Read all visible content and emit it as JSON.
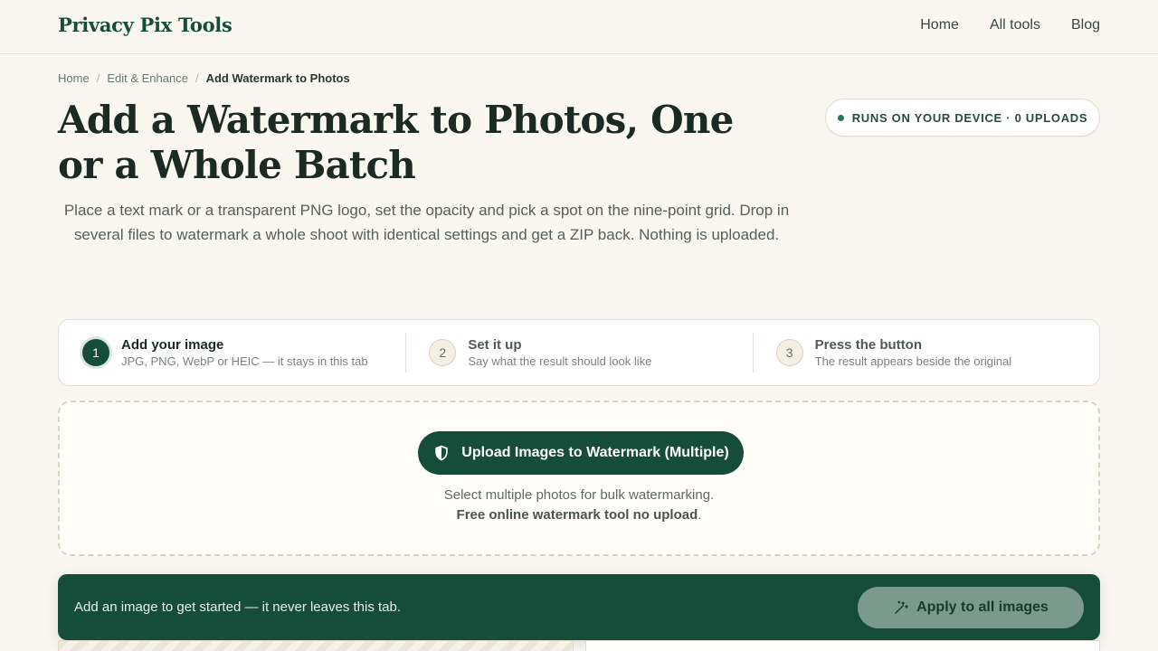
{
  "header": {
    "logo": "Privacy Pix Tools",
    "nav": [
      "Home",
      "All tools",
      "Blog"
    ]
  },
  "breadcrumb": {
    "items": [
      "Home",
      "Edit & Enhance"
    ],
    "current": "Add Watermark to Photos"
  },
  "page": {
    "title": "Add a Watermark to Photos, One or a Whole Batch",
    "badge": "RUNS ON YOUR DEVICE · 0 UPLOADS",
    "description": "Place a text mark or a transparent PNG logo, set the opacity and pick a spot on the nine-point grid. Drop in several files to watermark a whole shoot with identical settings and get a ZIP back. Nothing is uploaded."
  },
  "steps": [
    {
      "num": "1",
      "title": "Add your image",
      "sub": "JPG, PNG, WebP or HEIC — it stays in this tab"
    },
    {
      "num": "2",
      "title": "Set it up",
      "sub": "Say what the result should look like"
    },
    {
      "num": "3",
      "title": "Press the button",
      "sub": "The result appears beside the original"
    }
  ],
  "upload": {
    "button": "Upload Images to Watermark (Multiple)",
    "hint_plain": "Select multiple photos for bulk watermarking. ",
    "hint_bold": "Free online watermark tool no upload",
    "hint_end": "."
  },
  "actionbar": {
    "message": "Add an image to get started — it never leaves this tab.",
    "apply": "Apply to all images"
  },
  "icons": {
    "upload": "shield-icon",
    "apply": "magic-wand-icon",
    "badge": "status-dot"
  },
  "colors": {
    "brand": "#164d3a",
    "background": "#faf7f1",
    "status": "#1f7a55"
  }
}
